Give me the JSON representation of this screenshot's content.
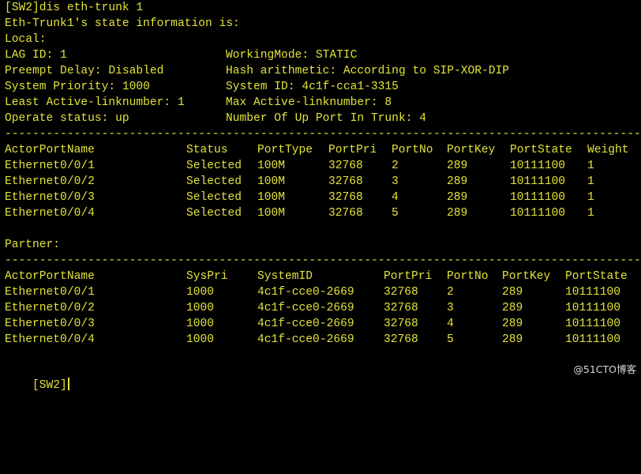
{
  "colors": {
    "background": "#000000",
    "text": "#e3e33a",
    "watermark": "#d8d8d8"
  },
  "terminal": {
    "command_line": "[SW2]dis eth-trunk 1",
    "header": "Eth-Trunk1's state information is:",
    "local_label": "Local:",
    "info_rows": [
      {
        "left": "LAG ID: 1",
        "right": "WorkingMode: STATIC"
      },
      {
        "left": "Preempt Delay: Disabled",
        "right": "Hash arithmetic: According to SIP-XOR-DIP"
      },
      {
        "left": "System Priority: 1000",
        "right": "System ID: 4c1f-cca1-3315"
      },
      {
        "left": "Least Active-linknumber: 1",
        "right": "Max Active-linknumber: 8"
      },
      {
        "left": "Operate status: up",
        "right": "Number Of Up Port In Trunk: 4"
      }
    ],
    "separator": "-----------------------------------------------------------------------------------------------",
    "local_table": {
      "columns": [
        "ActorPortName",
        "Status",
        "PortType",
        "PortPri",
        "PortNo",
        "PortKey",
        "PortState",
        "Weight"
      ],
      "rows": [
        [
          "Ethernet0/0/1",
          "Selected",
          "100M",
          "32768",
          "2",
          "289",
          "10111100",
          "1"
        ],
        [
          "Ethernet0/0/2",
          "Selected",
          "100M",
          "32768",
          "3",
          "289",
          "10111100",
          "1"
        ],
        [
          "Ethernet0/0/3",
          "Selected",
          "100M",
          "32768",
          "4",
          "289",
          "10111100",
          "1"
        ],
        [
          "Ethernet0/0/4",
          "Selected",
          "100M",
          "32768",
          "5",
          "289",
          "10111100",
          "1"
        ]
      ]
    },
    "partner_label": "Partner:",
    "partner_table": {
      "columns": [
        "ActorPortName",
        "SysPri",
        "SystemID",
        "PortPri",
        "PortNo",
        "PortKey",
        "PortState"
      ],
      "rows": [
        [
          "Ethernet0/0/1",
          "1000",
          "4c1f-cce0-2669",
          "32768",
          "2",
          "289",
          "10111100"
        ],
        [
          "Ethernet0/0/2",
          "1000",
          "4c1f-cce0-2669",
          "32768",
          "3",
          "289",
          "10111100"
        ],
        [
          "Ethernet0/0/3",
          "1000",
          "4c1f-cce0-2669",
          "32768",
          "4",
          "289",
          "10111100"
        ],
        [
          "Ethernet0/0/4",
          "1000",
          "4c1f-cce0-2669",
          "32768",
          "5",
          "289",
          "10111100"
        ]
      ]
    },
    "prompt": "[SW2]"
  },
  "watermark": "@51CTO博客"
}
